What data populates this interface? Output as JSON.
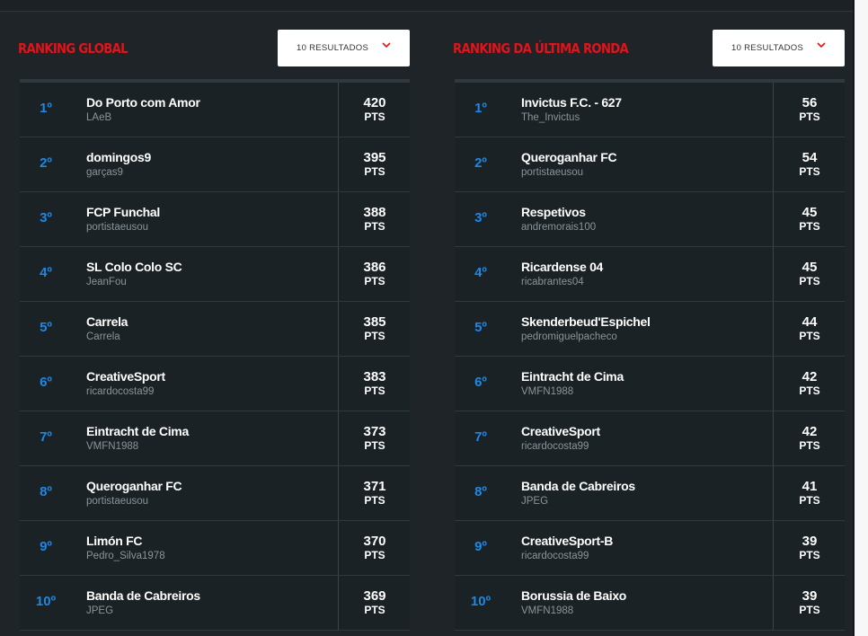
{
  "global": {
    "title": "RANKING GLOBAL",
    "select_value": "10 RESULTADOS",
    "pts_label": "PTS",
    "rows": [
      {
        "rank": "1º",
        "team": "Do Porto com Amor",
        "user": "LAeB",
        "pts": "420"
      },
      {
        "rank": "2º",
        "team": "domingos9",
        "user": "garças9",
        "pts": "395"
      },
      {
        "rank": "3º",
        "team": "FCP Funchal",
        "user": "portistaeusou",
        "pts": "388"
      },
      {
        "rank": "4º",
        "team": "SL Colo Colo SC",
        "user": "JeanFou",
        "pts": "386"
      },
      {
        "rank": "5º",
        "team": "Carrela",
        "user": "Carrela",
        "pts": "385"
      },
      {
        "rank": "6º",
        "team": "CreativeSport",
        "user": "ricardocosta99",
        "pts": "383"
      },
      {
        "rank": "7º",
        "team": "Eintracht de Cima",
        "user": "VMFN1988",
        "pts": "373"
      },
      {
        "rank": "8º",
        "team": "Queroganhar FC",
        "user": "portistaeusou",
        "pts": "371"
      },
      {
        "rank": "9º",
        "team": "Limón FC",
        "user": "Pedro_Silva1978",
        "pts": "370"
      },
      {
        "rank": "10º",
        "team": "Banda de Cabreiros",
        "user": "JPEG",
        "pts": "369"
      }
    ]
  },
  "last_round": {
    "title": "RANKING DA ÚLTIMA RONDA",
    "select_value": "10 RESULTADOS",
    "pts_label": "PTS",
    "rows": [
      {
        "rank": "1º",
        "team": "Invictus F.C. - 627",
        "user": "The_Invictus",
        "pts": "56"
      },
      {
        "rank": "2º",
        "team": "Queroganhar FC",
        "user": "portistaeusou",
        "pts": "54"
      },
      {
        "rank": "3º",
        "team": "Respetivos",
        "user": "andremorais100",
        "pts": "45"
      },
      {
        "rank": "4º",
        "team": "Ricardense 04",
        "user": "ricabrantes04",
        "pts": "45"
      },
      {
        "rank": "5º",
        "team": "Skenderbeud'Espichel",
        "user": "pedromiguelpacheco",
        "pts": "44"
      },
      {
        "rank": "6º",
        "team": "Eintracht de Cima",
        "user": "VMFN1988",
        "pts": "42"
      },
      {
        "rank": "7º",
        "team": "CreativeSport",
        "user": "ricardocosta99",
        "pts": "42"
      },
      {
        "rank": "8º",
        "team": "Banda de Cabreiros",
        "user": "JPEG",
        "pts": "41"
      },
      {
        "rank": "9º",
        "team": "CreativeSport-B",
        "user": "ricardocosta99",
        "pts": "39"
      },
      {
        "rank": "10º",
        "team": "Borussia de Baixo",
        "user": "VMFN1988",
        "pts": "39"
      }
    ]
  },
  "colors": {
    "accent_red": "#e1131b",
    "rank_blue": "#1e88e5",
    "background": "#1e2427"
  },
  "icons": {
    "select_chevron": "chevron-down-icon"
  }
}
